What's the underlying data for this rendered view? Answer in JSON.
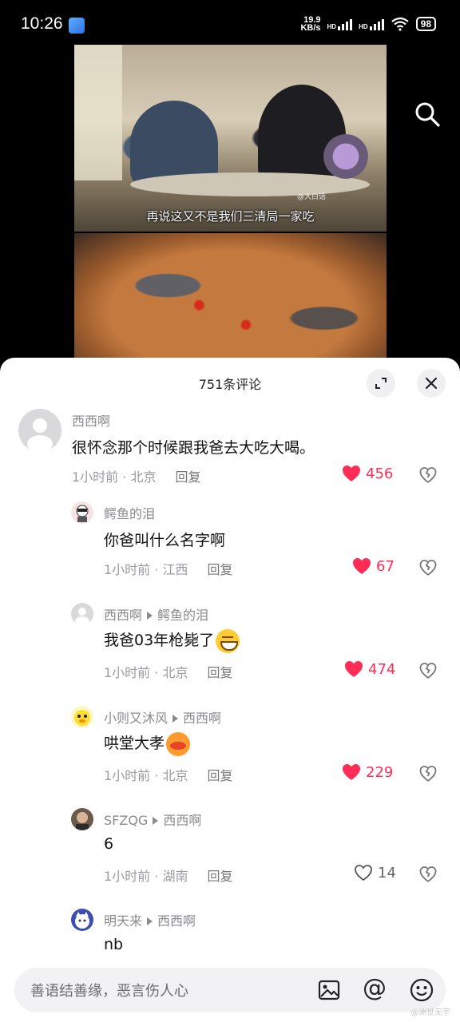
{
  "status_bar": {
    "time": "10:26",
    "net_speed": "19.9",
    "net_unit": "KB/s",
    "hd1": "HD",
    "hd2": "HD",
    "battery": "98"
  },
  "video": {
    "subtitle": "再说这又不是我们三清局一家吃",
    "watermark": "@大白话"
  },
  "comments_panel": {
    "title": "751条评论",
    "comments": [
      {
        "user": "西西啊",
        "reply_to": "",
        "text": "很怀念那个时候跟我爸去大吃大喝。",
        "time": "1小时前",
        "location": "北京",
        "reply_label": "回复",
        "likes": "456",
        "liked": true
      },
      {
        "user": "鳄鱼的泪",
        "reply_to": "",
        "text": "你爸叫什么名字啊",
        "time": "1小时前",
        "location": "江西",
        "reply_label": "回复",
        "likes": "67",
        "liked": true
      },
      {
        "user": "西西啊",
        "reply_to": "鳄鱼的泪",
        "text": "我爸03年枪毙了",
        "time": "1小时前",
        "location": "北京",
        "reply_label": "回复",
        "likes": "474",
        "liked": true
      },
      {
        "user": "小则又沐风",
        "reply_to": "西西啊",
        "text": "哄堂大孝",
        "time": "1小时前",
        "location": "北京",
        "reply_label": "回复",
        "likes": "229",
        "liked": true
      },
      {
        "user": "SFZQG",
        "reply_to": "西西啊",
        "text": "6",
        "time": "1小时前",
        "location": "湖南",
        "reply_label": "回复",
        "likes": "14",
        "liked": false
      },
      {
        "user": "明天来",
        "reply_to": "西西啊",
        "text": "nb"
      }
    ],
    "meta_sep": " · "
  },
  "input_bar": {
    "placeholder": "善语结善缘，恶言伤人心",
    "at_symbol": "@"
  },
  "corner_watermark": "@洲世无宇",
  "colors": {
    "like_red": "#ff2d55",
    "meta_gray": "#9a9aa0"
  },
  "icons": [
    "search-icon",
    "expand-icon",
    "close-icon",
    "heart-icon",
    "broken-heart-icon",
    "image-icon",
    "at-icon",
    "emoji-icon"
  ]
}
